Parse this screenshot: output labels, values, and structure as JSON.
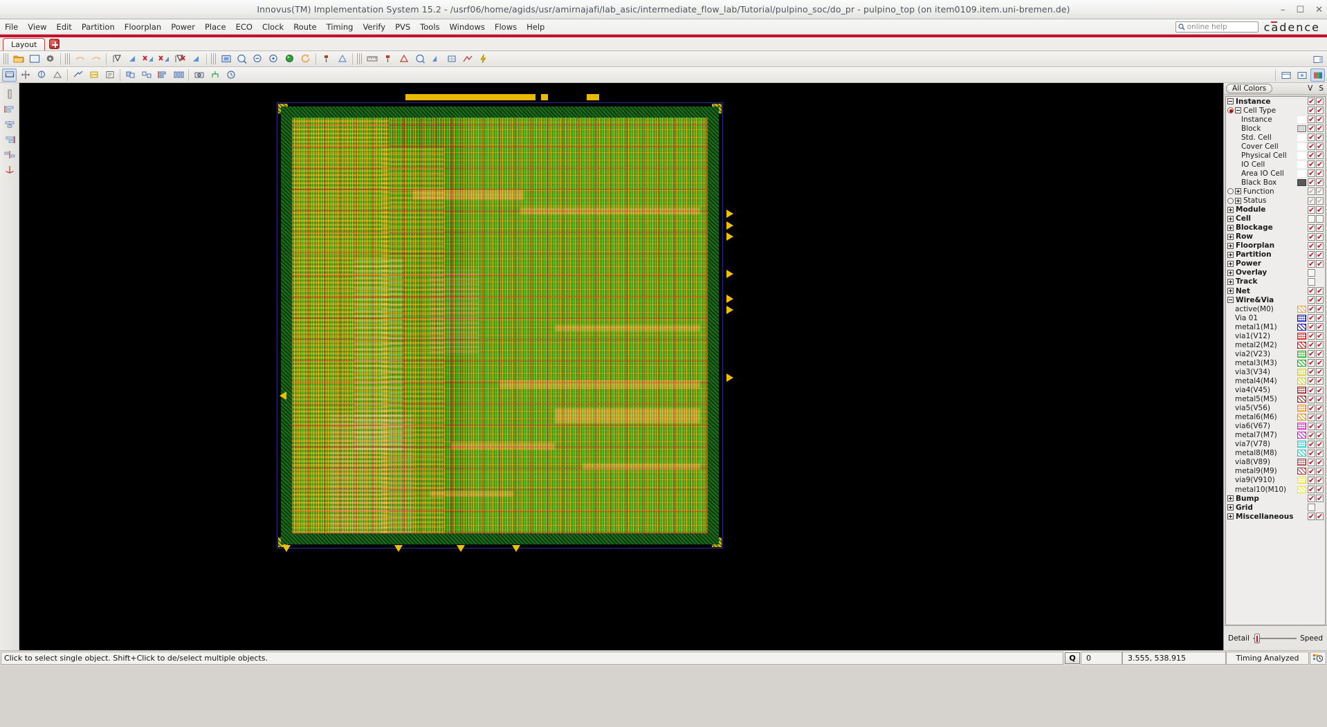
{
  "window": {
    "title": "Innovus(TM) Implementation System 15.2 - /usrf06/home/agids/usr/amirnajafi/lab_asic/intermediate_flow_lab/Tutorial/pulpino_soc/do_pr - pulpino_top (on item0109.item.uni-bremen.de)",
    "minimize": "–",
    "maximize": "☐",
    "close": "✕"
  },
  "menubar": {
    "items": [
      "File",
      "View",
      "Edit",
      "Partition",
      "Floorplan",
      "Power",
      "Place",
      "ECO",
      "Clock",
      "Route",
      "Timing",
      "Verify",
      "PVS",
      "Tools",
      "Windows",
      "Flows",
      "Help"
    ],
    "help_search_placeholder": "online help",
    "brand": "cadence"
  },
  "tabs": {
    "active": "Layout",
    "add_label": "+"
  },
  "panel": {
    "title": "All Colors",
    "col_v": "V",
    "col_s": "S",
    "footer": {
      "left_label": "Detail",
      "right_label": "Speed"
    },
    "rows": [
      {
        "label": "Instance",
        "level": 0,
        "expander": "minus",
        "bold": true,
        "v": "on",
        "s": "on"
      },
      {
        "label": "Cell Type",
        "level": 0,
        "expander": "minus",
        "radio": "on",
        "bold": false,
        "v": "on",
        "s": "on"
      },
      {
        "label": "Instance",
        "level": 2,
        "swatch": "#ffffff",
        "pattern": "dots",
        "v": "on",
        "s": "on"
      },
      {
        "label": "Block",
        "level": 2,
        "swatch": "#8a8a8a",
        "pattern": "dots",
        "v": "on",
        "s": "on"
      },
      {
        "label": "Std. Cell",
        "level": 2,
        "swatch": "#ffffff",
        "pattern": "dots",
        "v": "on",
        "s": "on"
      },
      {
        "label": "Cover Cell",
        "level": 2,
        "swatch": "#ffffff",
        "pattern": "dots",
        "v": "on",
        "s": "on"
      },
      {
        "label": "Physical Cell",
        "level": 2,
        "swatch": "#ffffff",
        "pattern": "dots",
        "v": "on",
        "s": "on"
      },
      {
        "label": "IO Cell",
        "level": 2,
        "swatch": "#ffffff",
        "pattern": "dots",
        "v": "on",
        "s": "on"
      },
      {
        "label": "Area IO Cell",
        "level": 2,
        "swatch": "#ffffff",
        "pattern": "dots",
        "v": "on",
        "s": "on"
      },
      {
        "label": "Black Box",
        "level": 2,
        "swatch": "#595959",
        "pattern": "solid",
        "v": "on",
        "s": "on"
      },
      {
        "label": "Function",
        "level": 0,
        "expander": "plus",
        "radio": "off",
        "v": "dim",
        "s": "dim"
      },
      {
        "label": "Status",
        "level": 0,
        "expander": "plus",
        "radio": "off",
        "v": "dim",
        "s": "dim"
      },
      {
        "label": "Module",
        "level": 0,
        "expander": "plus",
        "bold": true,
        "v": "on",
        "s": "on"
      },
      {
        "label": "Cell",
        "level": 0,
        "expander": "plus",
        "bold": true,
        "v": "off",
        "s": "off"
      },
      {
        "label": "Blockage",
        "level": 0,
        "expander": "plus",
        "bold": true,
        "v": "on",
        "s": "on"
      },
      {
        "label": "Row",
        "level": 0,
        "expander": "plus",
        "bold": true,
        "v": "on",
        "s": "on"
      },
      {
        "label": "Floorplan",
        "level": 0,
        "expander": "plus",
        "bold": true,
        "v": "on",
        "s": "on"
      },
      {
        "label": "Partition",
        "level": 0,
        "expander": "plus",
        "bold": true,
        "v": "on",
        "s": "on"
      },
      {
        "label": "Power",
        "level": 0,
        "expander": "plus",
        "bold": true,
        "v": "on",
        "s": "on"
      },
      {
        "label": "Overlay",
        "level": 0,
        "expander": "plus",
        "bold": true,
        "v": "off",
        "s": ""
      },
      {
        "label": "Track",
        "level": 0,
        "expander": "plus",
        "bold": true,
        "v": "off",
        "s": ""
      },
      {
        "label": "Net",
        "level": 0,
        "expander": "plus",
        "bold": true,
        "v": "on",
        "s": "on"
      },
      {
        "label": "Wire&Via",
        "level": 0,
        "expander": "minus",
        "bold": true,
        "v": "on",
        "s": "on"
      },
      {
        "label": "active(M0)",
        "level": 1,
        "swatch": "#e8a33d",
        "pattern": "hatch",
        "v": "on",
        "s": "on"
      },
      {
        "label": "Via 01",
        "level": 1,
        "swatch": "#1414c8",
        "pattern": "dots",
        "v": "on",
        "s": "on"
      },
      {
        "label": "metal1(M1)",
        "level": 1,
        "swatch": "#1414c8",
        "pattern": "hatch",
        "v": "on",
        "s": "on"
      },
      {
        "label": "via1(V12)",
        "level": 1,
        "swatch": "#e01010",
        "pattern": "dots",
        "v": "on",
        "s": "on"
      },
      {
        "label": "metal2(M2)",
        "level": 1,
        "swatch": "#e01010",
        "pattern": "hatch",
        "v": "on",
        "s": "on"
      },
      {
        "label": "via2(V23)",
        "level": 1,
        "swatch": "#16b416",
        "pattern": "dots",
        "v": "on",
        "s": "on"
      },
      {
        "label": "metal3(M3)",
        "level": 1,
        "swatch": "#16b416",
        "pattern": "hatch",
        "v": "on",
        "s": "on"
      },
      {
        "label": "via3(V34)",
        "level": 1,
        "swatch": "#d2d21e",
        "pattern": "dots",
        "v": "on",
        "s": "on"
      },
      {
        "label": "metal4(M4)",
        "level": 1,
        "swatch": "#d2d21e",
        "pattern": "hatch",
        "v": "on",
        "s": "on"
      },
      {
        "label": "via4(V45)",
        "level": 1,
        "swatch": "#9c2020",
        "pattern": "dots",
        "v": "on",
        "s": "on"
      },
      {
        "label": "metal5(M5)",
        "level": 1,
        "swatch": "#9c2020",
        "pattern": "hatch",
        "v": "on",
        "s": "on"
      },
      {
        "label": "via5(V56)",
        "level": 1,
        "swatch": "#f09010",
        "pattern": "dots",
        "v": "on",
        "s": "on"
      },
      {
        "label": "metal6(M6)",
        "level": 1,
        "swatch": "#f09010",
        "pattern": "hatch",
        "v": "on",
        "s": "on"
      },
      {
        "label": "via6(V67)",
        "level": 1,
        "swatch": "#d020d0",
        "pattern": "dots",
        "v": "on",
        "s": "on"
      },
      {
        "label": "metal7(M7)",
        "level": 1,
        "swatch": "#d020d0",
        "pattern": "hatch",
        "v": "on",
        "s": "on"
      },
      {
        "label": "via7(V78)",
        "level": 1,
        "swatch": "#18d0d0",
        "pattern": "dots",
        "v": "on",
        "s": "on"
      },
      {
        "label": "metal8(M8)",
        "level": 1,
        "swatch": "#18d0d0",
        "pattern": "hatch",
        "v": "on",
        "s": "on"
      },
      {
        "label": "via8(V89)",
        "level": 1,
        "swatch": "#b03a3a",
        "pattern": "dots",
        "v": "on",
        "s": "on"
      },
      {
        "label": "metal9(M9)",
        "level": 1,
        "swatch": "#b03a3a",
        "pattern": "hatch",
        "v": "on",
        "s": "on"
      },
      {
        "label": "via9(V910)",
        "level": 1,
        "swatch": "#f2e81c",
        "pattern": "dots",
        "v": "on",
        "s": "on"
      },
      {
        "label": "metal10(M10)",
        "level": 1,
        "swatch": "#f2e81c",
        "pattern": "hatch",
        "v": "on",
        "s": "on"
      },
      {
        "label": "Bump",
        "level": 0,
        "expander": "plus",
        "bold": true,
        "v": "on",
        "s": "on"
      },
      {
        "label": "Grid",
        "level": 0,
        "expander": "plus",
        "bold": true,
        "v": "off",
        "s": ""
      },
      {
        "label": "Miscellaneous",
        "level": 0,
        "expander": "plus",
        "bold": true,
        "v": "on",
        "s": "on"
      }
    ]
  },
  "statusbar": {
    "message": "Click to select single object. Shift+Click to de/select multiple objects.",
    "q_label": "Q",
    "count": "0",
    "coords": "3.555, 538.915",
    "timing": "Timing Analyzed"
  },
  "toolbar1": {
    "icons": [
      "open-folder-icon",
      "new-design-icon",
      "settings-gear-icon",
      "undo-icon",
      "redo-icon",
      "select-arrow-icon",
      "shape-edit-icon",
      "delete-shape-icon",
      "shape-move-icon",
      "delete-all-icon",
      "shape-cut-icon",
      "shape-split-icon",
      "fit-design-icon",
      "zoom-in-icon",
      "zoom-out-icon",
      "zoom-selected-icon",
      "zoom-previous-icon",
      "redraw-icon",
      "hierarchy-down-icon",
      "hierarchy-up-icon",
      "ruler-icon",
      "violation-browser-icon",
      "congestion-icon",
      "density-icon",
      "amoeba-view-icon",
      "physical-view-icon",
      "net-view-icon",
      "power-view-icon"
    ]
  },
  "toolbar2": {
    "icons": [
      "select-tool-icon",
      "move-tool-icon",
      "stretch-tool-icon",
      "cut-tool-icon",
      "edit-wire-icon",
      "pin-editor-icon",
      "attribute-editor-icon",
      "group-icon",
      "ungroup-icon",
      "align-icon",
      "distribute-icon",
      "snapshot-icon",
      "clock-tree-icon",
      "timing-icon",
      "library-icon",
      "panel-toggle-icon",
      "colors-toggle-icon"
    ]
  },
  "leftrail": {
    "icons": [
      "ruler-vertical-icon",
      "align-left-icon",
      "align-center-icon",
      "align-right-icon",
      "distribute-icon",
      "anchor-icon"
    ]
  },
  "canvas": {
    "design_name": "pulpino_top"
  }
}
